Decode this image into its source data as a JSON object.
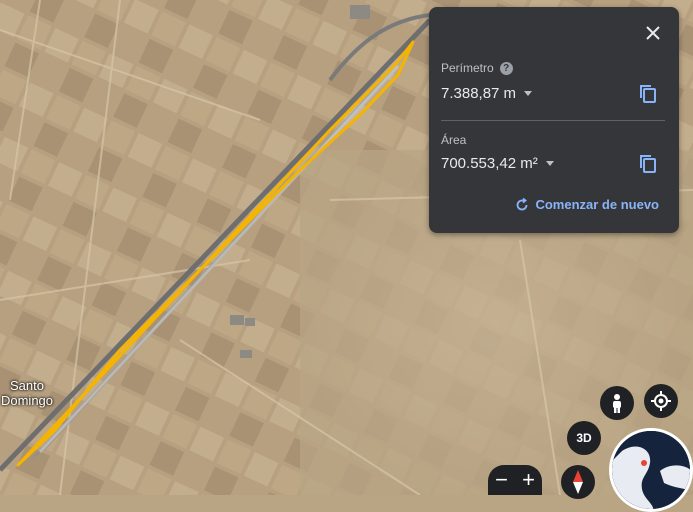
{
  "map": {
    "place_label": "Santo Domingo"
  },
  "measure_panel": {
    "perimeter": {
      "label": "Perímetro",
      "help_glyph": "?",
      "value": "7.388,87 m"
    },
    "area": {
      "label": "Área",
      "value": "700.553,42 m²"
    },
    "restart_label": "Comenzar de nuevo"
  },
  "controls": {
    "btn_3d": "3D",
    "zoom_out": "−",
    "zoom_in": "+"
  },
  "colors": {
    "polygon_outline": "#f4b400",
    "panel_bg": "#35363a",
    "link": "#8ab4f8"
  },
  "icons": [
    "close-icon",
    "help-icon",
    "copy-icon",
    "restart-icon",
    "pegman-icon",
    "my-location-icon",
    "compass-icon",
    "globe-icon"
  ]
}
